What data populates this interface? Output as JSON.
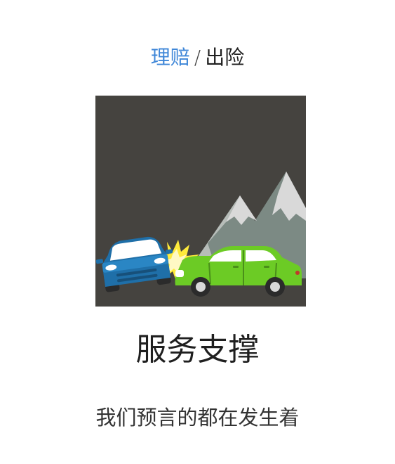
{
  "breadcrumb": {
    "active_label": "理赔",
    "separator": "/",
    "current_label": "出险"
  },
  "illustration": {
    "icon": "car-accident-icon",
    "background": "#45433f",
    "car_left_color": "#2a7fb8",
    "car_right_color": "#6ccb25",
    "mountain_color": "#7c8a84",
    "impact_color": "#ffeb3b"
  },
  "section": {
    "title": "服务支撑",
    "subtitle": "我们预言的都在发生着"
  }
}
